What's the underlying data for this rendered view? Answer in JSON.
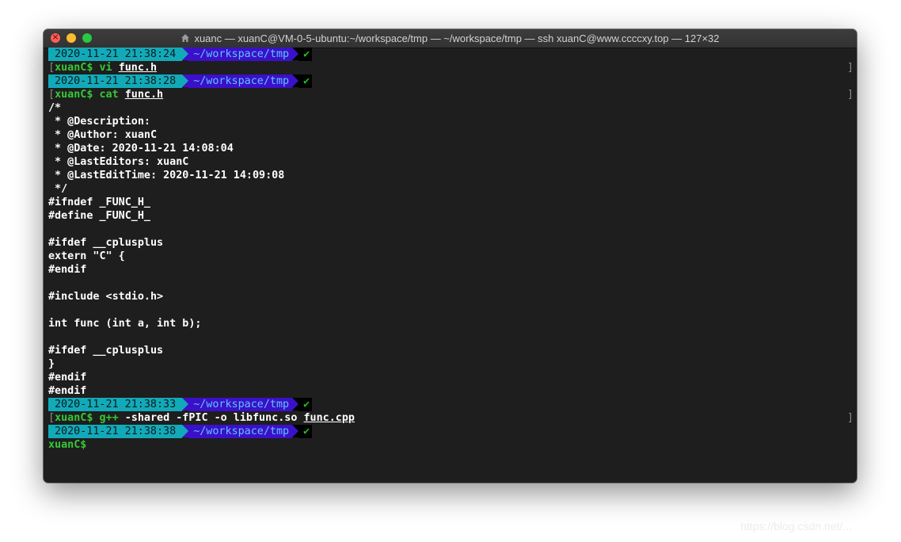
{
  "window": {
    "title": "xuanc — xuanC@VM-0-5-ubuntu:~/workspace/tmp — ~/workspace/tmp — ssh xuanC@www.ccccxy.top — 127×32"
  },
  "prompt_blocks": [
    {
      "timestamp": "2020-11-21 21:38:24",
      "path": "~/workspace/tmp",
      "status": "✔"
    },
    {
      "timestamp": "2020-11-21 21:38:28",
      "path": "~/workspace/tmp",
      "status": "✔"
    },
    {
      "timestamp": "2020-11-21 21:38:33",
      "path": "~/workspace/tmp",
      "status": "✔"
    },
    {
      "timestamp": "2020-11-21 21:38:38",
      "path": "~/workspace/tmp",
      "status": "✔"
    }
  ],
  "commands": [
    {
      "prompt": "xuanC$ ",
      "cmd": "vi",
      "args": " ",
      "file": "func.h"
    },
    {
      "prompt": "xuanC$ ",
      "cmd": "cat",
      "args": " ",
      "file": "func.h"
    },
    {
      "prompt": "xuanC$ ",
      "cmd": "g++",
      "args": " -shared -fPIC -o libfunc.so ",
      "file": "func.cpp"
    },
    {
      "prompt": "xuanC$"
    }
  ],
  "bracket_left": "[",
  "bracket_right": "]",
  "output_lines": [
    "/*",
    " * @Description:",
    " * @Author: xuanC",
    " * @Date: 2020-11-21 14:08:04",
    " * @LastEditors: xuanC",
    " * @LastEditTime: 2020-11-21 14:09:08",
    " */",
    "#ifndef _FUNC_H_",
    "#define _FUNC_H_",
    "",
    "#ifdef __cplusplus",
    "extern \"C\" {",
    "#endif",
    "",
    "#include <stdio.h>",
    "",
    "int func (int a, int b);",
    "",
    "#ifdef __cplusplus",
    "}",
    "#endif",
    "#endif"
  ],
  "watermark": "https://blog.csdn.net/..."
}
